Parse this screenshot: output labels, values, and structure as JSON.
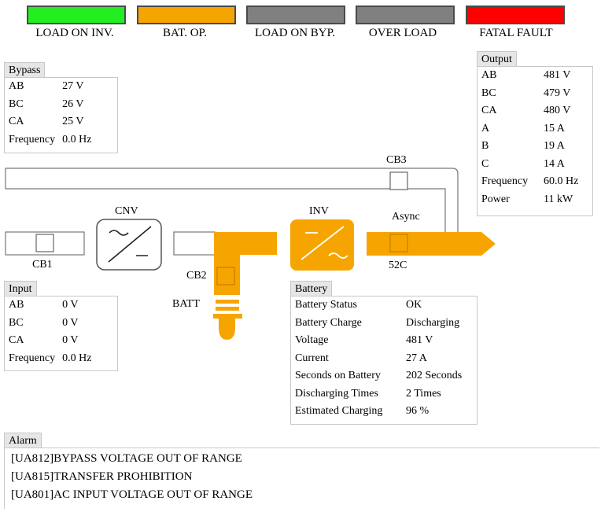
{
  "colors": {
    "load_on_inv": "#22ee22",
    "bat_op": "#f6a500",
    "load_on_byp": "#808080",
    "over_load": "#808080",
    "fatal_fault": "#ff0000",
    "power_flow": "#f6a500"
  },
  "indicators": {
    "load_on_inv": "LOAD ON INV.",
    "bat_op": "BAT. OP.",
    "load_on_byp": "LOAD ON BYP.",
    "over_load": "OVER LOAD",
    "fatal_fault": "FATAL FAULT"
  },
  "bypass": {
    "title": "Bypass",
    "rows": [
      {
        "label": "AB",
        "value": "27 V"
      },
      {
        "label": "BC",
        "value": "26 V"
      },
      {
        "label": "CA",
        "value": "25 V"
      },
      {
        "label": "Frequency",
        "value": "0.0 Hz"
      }
    ]
  },
  "output": {
    "title": "Output",
    "rows": [
      {
        "label": "AB",
        "value": "481 V"
      },
      {
        "label": "BC",
        "value": "479 V"
      },
      {
        "label": "CA",
        "value": "480 V"
      },
      {
        "label": "A",
        "value": "15 A"
      },
      {
        "label": "B",
        "value": "19 A"
      },
      {
        "label": "C",
        "value": "14 A"
      },
      {
        "label": "Frequency",
        "value": "60.0 Hz"
      },
      {
        "label": "Power",
        "value": "11 kW"
      }
    ]
  },
  "input": {
    "title": "Input",
    "rows": [
      {
        "label": "AB",
        "value": "0 V"
      },
      {
        "label": "BC",
        "value": "0 V"
      },
      {
        "label": "CA",
        "value": "0 V"
      },
      {
        "label": "Frequency",
        "value": "0.0 Hz"
      }
    ]
  },
  "battery": {
    "title": "Battery",
    "rows": [
      {
        "label": "Battery Status",
        "value": "OK"
      },
      {
        "label": "Battery Charge",
        "value": "Discharging"
      },
      {
        "label": "Voltage",
        "value": "481 V"
      },
      {
        "label": "Current",
        "value": "27 A"
      },
      {
        "label": "Seconds on Battery",
        "value": "202 Seconds"
      },
      {
        "label": "Discharging Times",
        "value": "2 Times"
      },
      {
        "label": "Estimated Charging",
        "value": "96 %"
      }
    ]
  },
  "diagram": {
    "cb1": "CB1",
    "cb2": "CB2",
    "cb3": "CB3",
    "cnv": "CNV",
    "inv": "INV",
    "async": "Async",
    "c52": "52C",
    "batt": "BATT"
  },
  "alarm": {
    "title": "Alarm",
    "items": [
      "[UA812]BYPASS VOLTAGE OUT OF RANGE",
      "[UA815]TRANSFER PROHIBITION",
      "[UA801]AC INPUT VOLTAGE OUT OF RANGE"
    ]
  }
}
